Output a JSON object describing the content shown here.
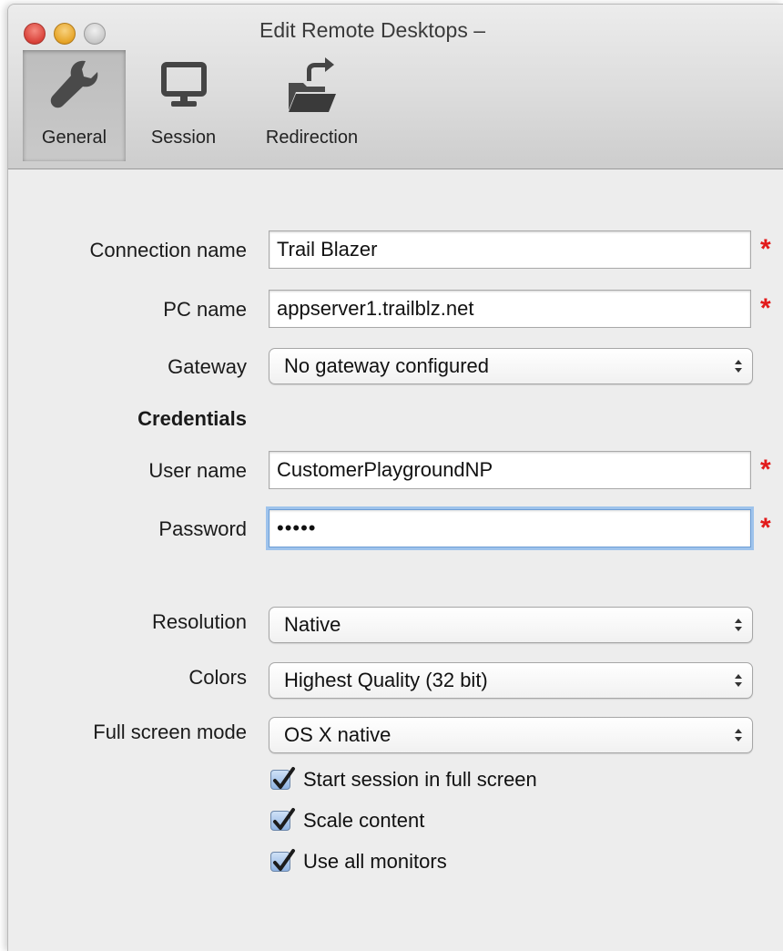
{
  "window": {
    "title": "Edit Remote Desktops –"
  },
  "toolbar": {
    "tabs": [
      {
        "label": "General",
        "icon": "wrench-icon",
        "active": true
      },
      {
        "label": "Session",
        "icon": "monitor-icon",
        "active": false
      },
      {
        "label": "Redirection",
        "icon": "folder-redirect-icon",
        "active": false
      }
    ]
  },
  "form": {
    "connection_name": {
      "label": "Connection name",
      "value": "Trail Blazer",
      "required": "*"
    },
    "pc_name": {
      "label": "PC name",
      "value": "appserver1.trailblz.net",
      "required": "*"
    },
    "gateway": {
      "label": "Gateway",
      "value": "No gateway configured"
    },
    "credentials_heading": "Credentials",
    "user_name": {
      "label": "User name",
      "value": "CustomerPlaygroundNP",
      "required": "*"
    },
    "password": {
      "label": "Password",
      "value": "•••••",
      "required": "*"
    },
    "resolution": {
      "label": "Resolution",
      "value": "Native"
    },
    "colors": {
      "label": "Colors",
      "value": "Highest Quality (32 bit)"
    },
    "full_screen_mode": {
      "label": "Full screen mode",
      "value": "OS X native"
    },
    "checkboxes": [
      {
        "label": "Start session in full screen",
        "checked": true
      },
      {
        "label": "Scale content",
        "checked": true
      },
      {
        "label": "Use all monitors",
        "checked": true
      }
    ]
  },
  "colors": {
    "required_star": "#e21a1a",
    "focus_ring": "#9ec3ec",
    "checkbox_fill": "#8fb3e3"
  }
}
